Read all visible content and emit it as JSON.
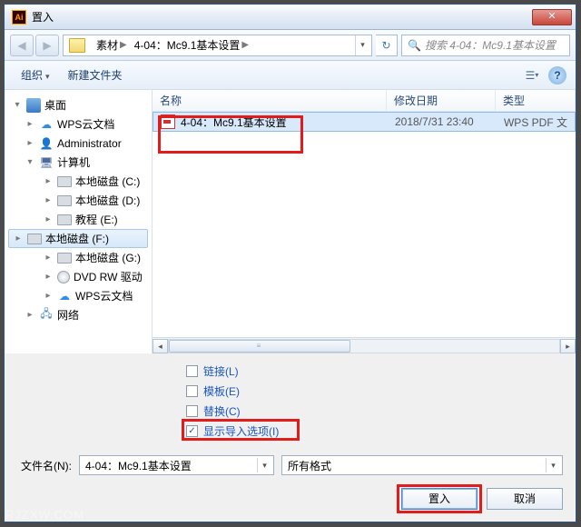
{
  "title": "置入",
  "path": {
    "seg1": "素材",
    "seg2": "4-04：Mc9.1基本设置"
  },
  "search_placeholder": "搜索 4-04：Mc9.1基本设置",
  "toolbar": {
    "organize": "组织",
    "new_folder": "新建文件夹"
  },
  "columns": {
    "name": "名称",
    "date": "修改日期",
    "type": "类型"
  },
  "tree": {
    "desktop": "桌面",
    "wpscloud": "WPS云文档",
    "admin": "Administrator",
    "computer": "计算机",
    "drive_c": "本地磁盘 (C:)",
    "drive_d": "本地磁盘 (D:)",
    "drive_e": "教程 (E:)",
    "drive_f": "本地磁盘 (F:)",
    "drive_g": "本地磁盘 (G:)",
    "dvd": "DVD RW 驱动",
    "wpscloud2": "WPS云文档",
    "network": "网络"
  },
  "file": {
    "name": "4-04：Mc9.1基本设置",
    "date": "2018/7/31 23:40",
    "type": "WPS PDF 文"
  },
  "options": {
    "link": "链接(L)",
    "template": "模板(E)",
    "replace": "替换(C)",
    "show_import": "显示导入选项(I)"
  },
  "filename_label": "文件名(N):",
  "filename_value": "4-04：Mc9.1基本设置",
  "filter_value": "所有格式",
  "buttons": {
    "place": "置入",
    "cancel": "取消"
  },
  "checkmark": "✓",
  "watermark": "RJZXW.COM"
}
